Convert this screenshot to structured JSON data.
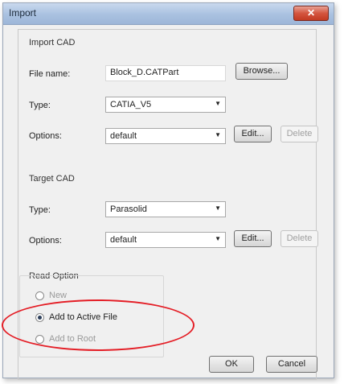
{
  "window": {
    "title": "Import",
    "close_glyph": "✕"
  },
  "import_cad": {
    "section_label": "Import CAD",
    "file_name_label": "File name:",
    "file_name_value": "Block_D.CATPart",
    "browse_label": "Browse...",
    "type_label": "Type:",
    "type_value": "CATIA_V5",
    "options_label": "Options:",
    "options_value": "default",
    "edit_label": "Edit...",
    "delete_label": "Delete"
  },
  "target_cad": {
    "section_label": "Target CAD",
    "type_label": "Type:",
    "type_value": "Parasolid",
    "options_label": "Options:",
    "options_value": "default",
    "edit_label": "Edit...",
    "delete_label": "Delete"
  },
  "read_option": {
    "section_label": "Read Option",
    "options": [
      {
        "label": "New",
        "checked": false
      },
      {
        "label": "Add to Active File",
        "checked": true
      },
      {
        "label": "Add to Root",
        "checked": false
      }
    ]
  },
  "footer": {
    "ok_label": "OK",
    "cancel_label": "Cancel"
  },
  "colors": {
    "highlight": "#e41e26",
    "titlebar": "#a9c1e0",
    "close": "#c23a22"
  },
  "icons": {
    "dropdown": "chevron-down-icon",
    "close": "close-icon"
  }
}
